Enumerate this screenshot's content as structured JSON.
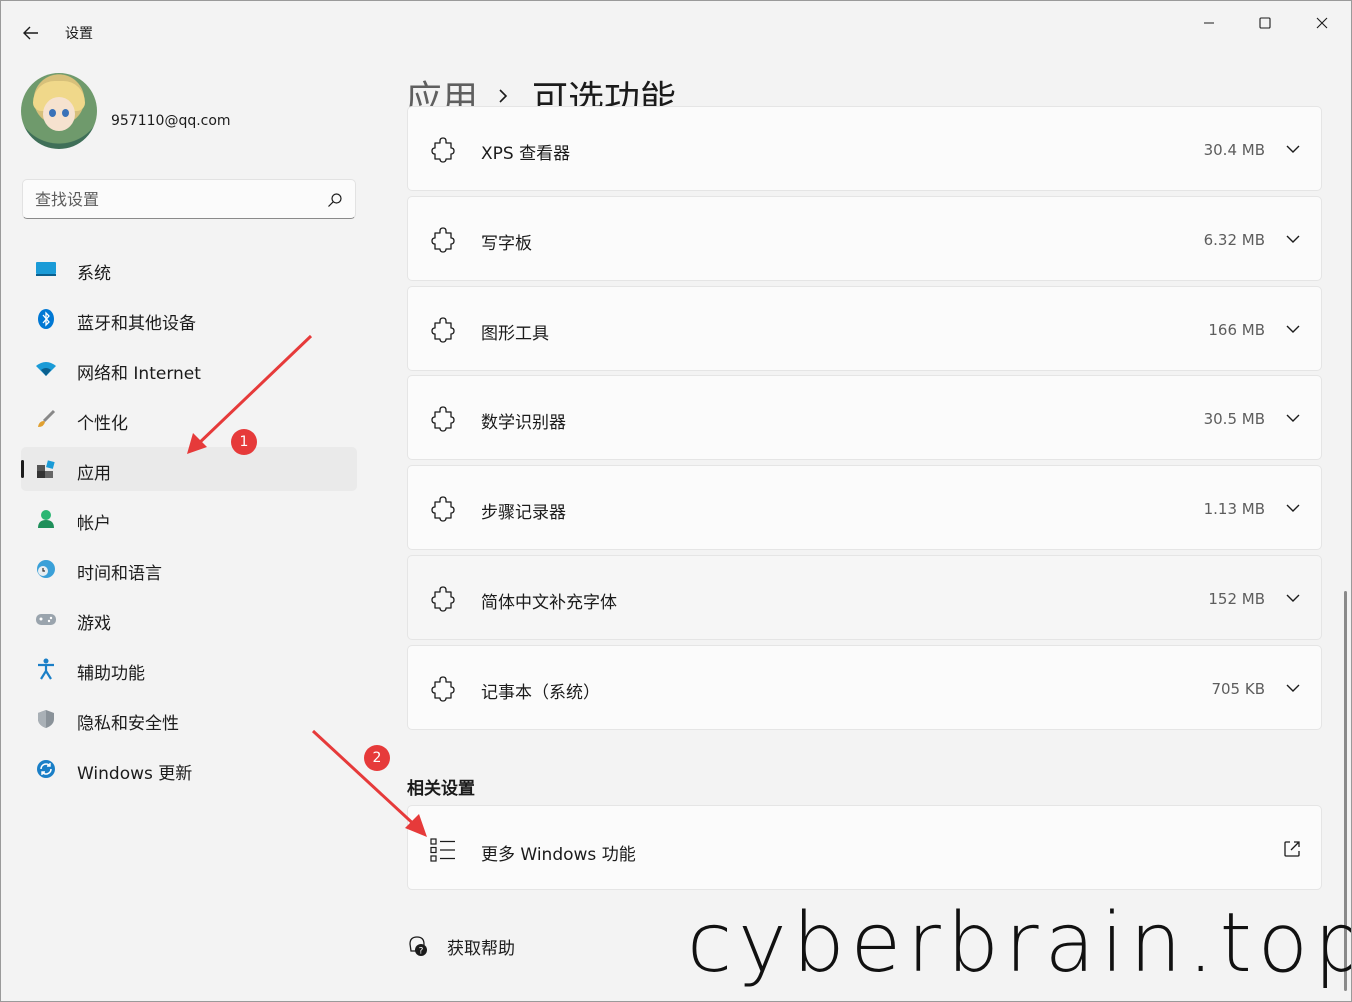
{
  "window": {
    "title": "设置",
    "controls": [
      "minimize",
      "maximize",
      "close"
    ]
  },
  "profile": {
    "email": "957110@qq.com"
  },
  "search": {
    "placeholder": "查找设置"
  },
  "sidebar": {
    "items": [
      {
        "label": "系统",
        "icon": "system-icon"
      },
      {
        "label": "蓝牙和其他设备",
        "icon": "bluetooth-icon"
      },
      {
        "label": "网络和 Internet",
        "icon": "wifi-icon"
      },
      {
        "label": "个性化",
        "icon": "brush-icon"
      },
      {
        "label": "应用",
        "icon": "apps-icon",
        "active": true
      },
      {
        "label": "帐户",
        "icon": "account-icon"
      },
      {
        "label": "时间和语言",
        "icon": "globe-clock-icon"
      },
      {
        "label": "游戏",
        "icon": "gamepad-icon"
      },
      {
        "label": "辅助功能",
        "icon": "accessibility-icon"
      },
      {
        "label": "隐私和安全性",
        "icon": "shield-icon"
      },
      {
        "label": "Windows 更新",
        "icon": "update-icon"
      }
    ]
  },
  "breadcrumb": {
    "parent": "应用",
    "current": "可选功能"
  },
  "features": [
    {
      "name": "XPS 查看器",
      "size": "30.4 MB"
    },
    {
      "name": "写字板",
      "size": "6.32 MB"
    },
    {
      "name": "图形工具",
      "size": "166 MB"
    },
    {
      "name": "数学识别器",
      "size": "30.5 MB"
    },
    {
      "name": "步骤记录器",
      "size": "1.13 MB"
    },
    {
      "name": "简体中文补充字体",
      "size": "152 MB"
    },
    {
      "name": "记事本（系统）",
      "size": "705 KB"
    }
  ],
  "related": {
    "title": "相关设置",
    "item_label": "更多 Windows 功能"
  },
  "help": {
    "label": "获取帮助"
  },
  "annotations": {
    "badge1": "1",
    "badge2": "2",
    "color": "#e63a3a"
  },
  "watermark": "cyberbrain.top",
  "colors": {
    "background": "#f3f3f3",
    "card": "#fbfbfb",
    "bluetooth": "#0078d4",
    "accent": "#0067c0"
  }
}
